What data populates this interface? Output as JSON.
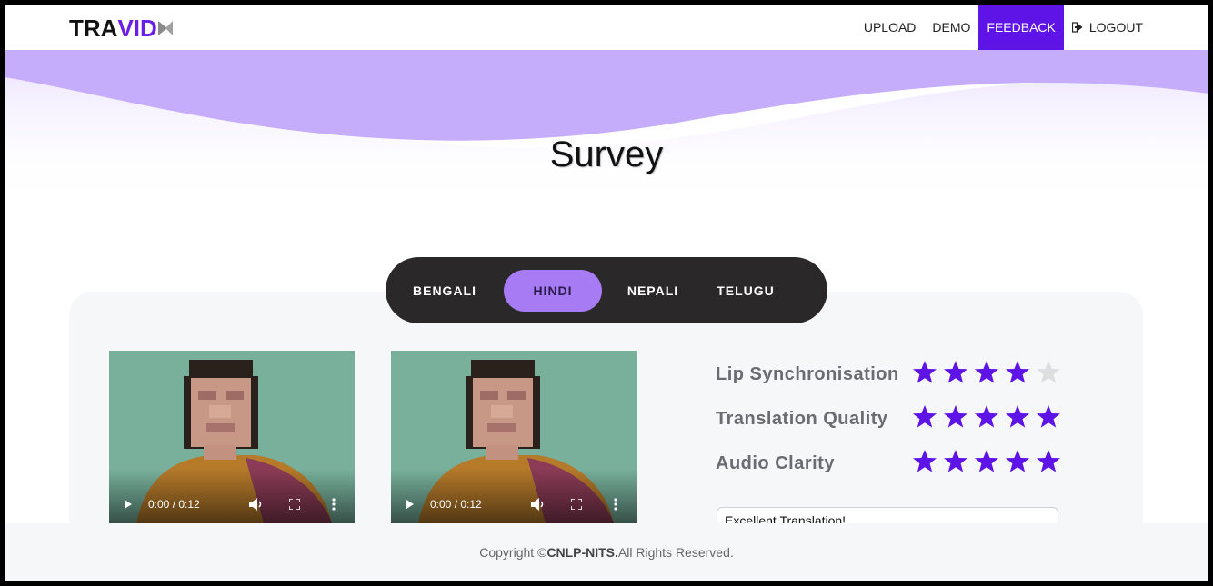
{
  "brand": {
    "part1": "TRA",
    "part2": "VID",
    "icon": "video-camera-icon"
  },
  "nav": {
    "items": [
      {
        "label": "UPLOAD"
      },
      {
        "label": "DEMO"
      },
      {
        "label": "FEEDBACK",
        "active": true
      },
      {
        "label": "LOGOUT",
        "icon": "logout-icon"
      }
    ]
  },
  "page": {
    "title": "Survey"
  },
  "languages": {
    "tabs": [
      {
        "label": "BENGALI"
      },
      {
        "label": "HINDI",
        "active": true
      },
      {
        "label": "NEPALI"
      },
      {
        "label": "TELUGU"
      }
    ]
  },
  "videos": [
    {
      "time": "0:00 / 0:12"
    },
    {
      "time": "0:00 / 0:12"
    }
  ],
  "ratings": [
    {
      "label": "Lip Synchronisation",
      "stars": 4,
      "max": 5
    },
    {
      "label": "Translation Quality",
      "stars": 5,
      "max": 5
    },
    {
      "label": "Audio Clarity",
      "stars": 5,
      "max": 5
    }
  ],
  "feedback": {
    "value": "Excellent Translation!"
  },
  "footer": {
    "prefix": "Copyright © ",
    "org": "CNLP-NITS.",
    "suffix": " All Rights Reserved."
  },
  "colors": {
    "accent": "#5e14e6",
    "wave": "#c6adfb",
    "tab_active": "#a77bf3",
    "star_on": "#5e14e6",
    "star_off": "#dedede"
  }
}
